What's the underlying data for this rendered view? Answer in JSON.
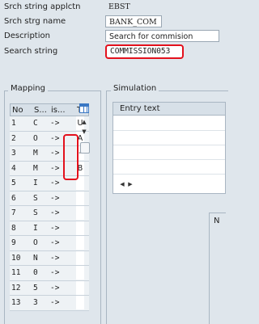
{
  "form": {
    "fields": [
      {
        "label": "Srch string applctn",
        "value": "EBST"
      },
      {
        "label": "Srch strg name",
        "value": "BANK_COM"
      },
      {
        "label": "Description",
        "value": "Search for commision"
      },
      {
        "label": "Search string",
        "value": "COMMISSION053"
      }
    ]
  },
  "mapping": {
    "title": "Mapping",
    "columns": [
      "No",
      "S...",
      "is...",
      "T..."
    ],
    "rows": [
      {
        "no": "1",
        "s": "C",
        "is": "->",
        "t": "U"
      },
      {
        "no": "2",
        "s": "O",
        "is": "->",
        "t": "A"
      },
      {
        "no": "3",
        "s": "M",
        "is": "->",
        "t": "-"
      },
      {
        "no": "4",
        "s": "M",
        "is": "->",
        "t": "B"
      },
      {
        "no": "5",
        "s": "I",
        "is": "->",
        "t": ""
      },
      {
        "no": "6",
        "s": "S",
        "is": "->",
        "t": ""
      },
      {
        "no": "7",
        "s": "S",
        "is": "->",
        "t": ""
      },
      {
        "no": "8",
        "s": "I",
        "is": "->",
        "t": ""
      },
      {
        "no": "9",
        "s": "O",
        "is": "->",
        "t": ""
      },
      {
        "no": "10",
        "s": "N",
        "is": "->",
        "t": ""
      },
      {
        "no": "11",
        "s": "0",
        "is": "->",
        "t": ""
      },
      {
        "no": "12",
        "s": "5",
        "is": "->",
        "t": ""
      },
      {
        "no": "13",
        "s": "3",
        "is": "->",
        "t": ""
      }
    ]
  },
  "simulation": {
    "title": "Simulation",
    "column": "Entry text",
    "lower_label": "N"
  },
  "icons": {
    "up": "▲",
    "down": "▼",
    "left": "◀",
    "right": "▶",
    "table_settings": "table-settings-icon"
  },
  "colors": {
    "highlight": "#e3111d",
    "accent": "#3a78c4"
  }
}
